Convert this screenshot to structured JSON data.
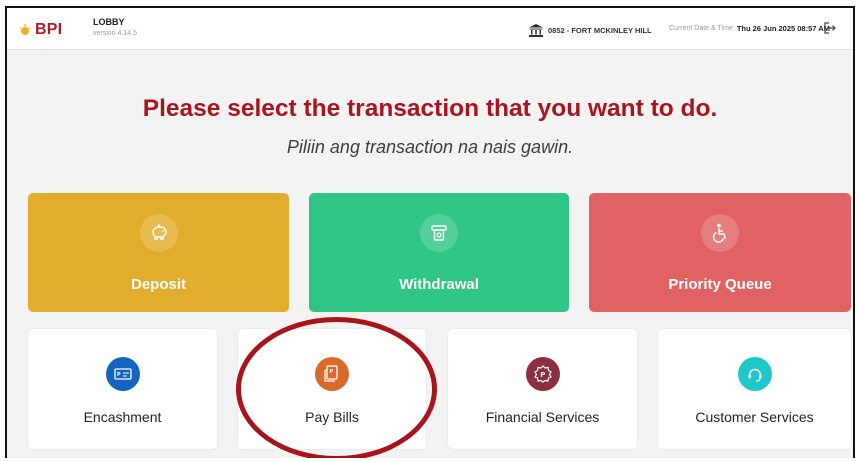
{
  "header": {
    "logo_text": "BPI",
    "lobby_title": "LOBBY",
    "version": "version 4.14.5",
    "branch": "0852 - FORT MCKINLEY HILL",
    "datetime_label": "Current Date & Time",
    "datetime_value": "Thu 26 Jun 2025 08:57 AM"
  },
  "main": {
    "heading": "Please select the transaction that you want to do.",
    "subheading": "Piliin ang transaction na nais gawin."
  },
  "primary_actions": [
    {
      "label": "Deposit",
      "icon": "piggy-bank-icon",
      "color": "#e2ad2c"
    },
    {
      "label": "Withdrawal",
      "icon": "cash-dispense-icon",
      "color": "#2ec585"
    },
    {
      "label": "Priority Queue",
      "icon": "wheelchair-icon",
      "color": "#e06262"
    }
  ],
  "secondary_actions": [
    {
      "label": "Encashment",
      "icon": "check-icon",
      "color": "#1565c0"
    },
    {
      "label": "Pay Bills",
      "icon": "bill-icon",
      "color": "#d96a2c"
    },
    {
      "label": "Financial Services",
      "icon": "gear-peso-icon",
      "color": "#8b2e3f"
    },
    {
      "label": "Customer Services",
      "icon": "headset-icon",
      "color": "#1ec8c8"
    }
  ],
  "colors": {
    "brand_red": "#a8161d",
    "highlight_ring": "#a8141c"
  }
}
